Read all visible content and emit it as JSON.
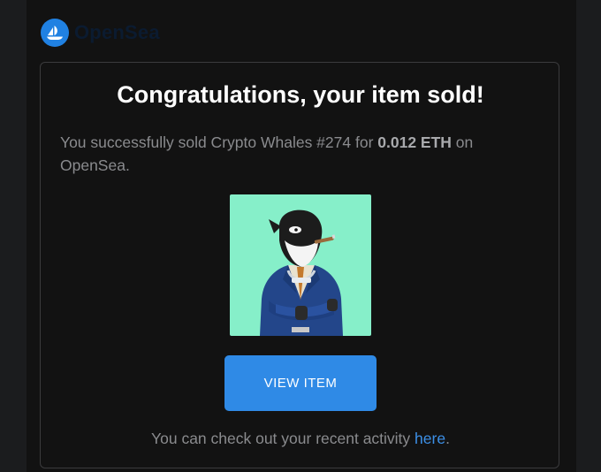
{
  "header": {
    "brand": "OpenSea",
    "logo_icon": "opensea-boat-icon"
  },
  "email": {
    "title": "Congratulations, your item sold!",
    "message": {
      "prefix": "You successfully sold Crypto Whales #274 for ",
      "price": "0.012 ETH",
      "suffix": " on OpenSea."
    },
    "item_image_icon": "crypto-whale-nft-image",
    "button_label": "VIEW ITEM",
    "footer": {
      "prefix": "You can check out your recent activity ",
      "link": "here",
      "suffix": "."
    }
  },
  "colors": {
    "background": "#121212",
    "accent": "#2f8ae6",
    "link": "#3c8fe6",
    "nft_background": "#86efc9"
  }
}
